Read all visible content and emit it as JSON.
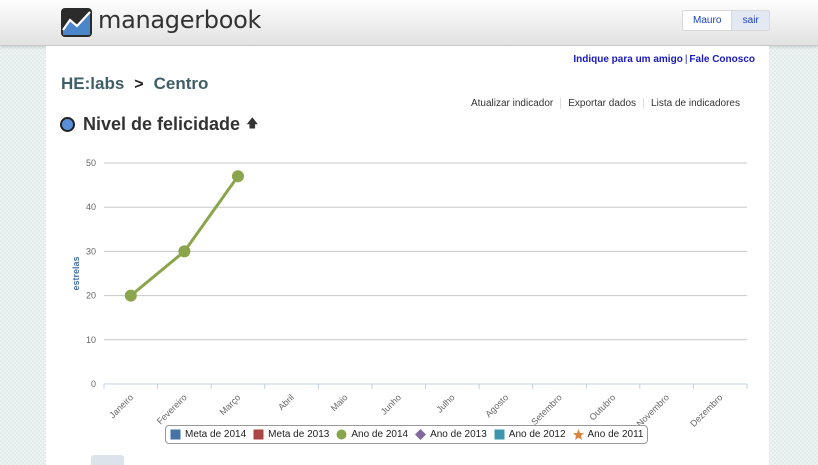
{
  "app": {
    "brand": "managerbook"
  },
  "user": {
    "name": "Mauro",
    "logout_label": "sair"
  },
  "top_links": {
    "refer": "Indique para um amigo",
    "separator": "|",
    "contact": "Fale Conosco"
  },
  "breadcrumb": {
    "org": "HE:labs",
    "separator": ">",
    "unit": "Centro"
  },
  "actions": [
    "Atualizar indicador",
    "Exportar dados",
    "Lista de indicadores"
  ],
  "indicator": {
    "title": "Nivel de felicidade",
    "trend_icon": "arrow-up-icon",
    "dot_color": "#5a90d8"
  },
  "chart_data": {
    "type": "line",
    "ylabel": "estrelas",
    "xlabel": "",
    "ylim": [
      0,
      50
    ],
    "yticks": [
      0,
      10,
      20,
      30,
      40,
      50
    ],
    "grid": true,
    "categories": [
      "Janeiro",
      "Fevereiro",
      "Março",
      "Abril",
      "Maio",
      "Junho",
      "Julho",
      "Agosto",
      "Setembro",
      "Outubro",
      "Novembro",
      "Dezembro"
    ],
    "series": [
      {
        "name": "Ano de 2014",
        "values": [
          20,
          30,
          47
        ],
        "color": "#8aa54b"
      }
    ],
    "legend_placement": "bottom-center",
    "legend": [
      {
        "label": "Meta de 2014",
        "marker": "square",
        "color": "#4572a7"
      },
      {
        "label": "Meta de 2013",
        "marker": "square",
        "color": "#aa4643"
      },
      {
        "label": "Ano de 2014",
        "marker": "circle",
        "color": "#89a54e"
      },
      {
        "label": "Ano de 2013",
        "marker": "diamond",
        "color": "#80699b"
      },
      {
        "label": "Ano de 2012",
        "marker": "square",
        "color": "#3d96ae"
      },
      {
        "label": "Ano de 2011",
        "marker": "star",
        "color": "#db843d"
      }
    ]
  }
}
